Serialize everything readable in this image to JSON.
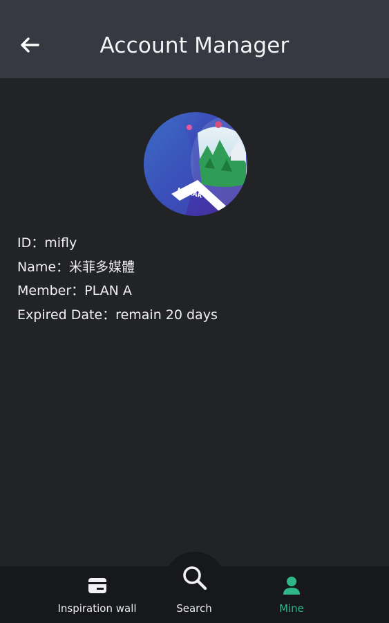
{
  "header": {
    "title": "Account Manager",
    "back_icon": "arrow-left-icon"
  },
  "profile": {
    "avatar_logo_text": "MAKAR",
    "id_line": "ID：mifly",
    "name_line": "Name：米菲多媒體",
    "member_line": "Member：PLAN A",
    "expired_line": "Expired Date：remain 20 days"
  },
  "bottom_nav": {
    "items": [
      {
        "label": "Inspiration wall",
        "icon": "card-icon",
        "active": false
      },
      {
        "label": "Search",
        "icon": "search-icon",
        "active": false
      },
      {
        "label": "Mine",
        "icon": "person-icon",
        "active": true
      }
    ]
  },
  "colors": {
    "background": "#222327",
    "app_bar": "#363842",
    "nav_bar": "#17181b",
    "accent": "#2fb788"
  }
}
